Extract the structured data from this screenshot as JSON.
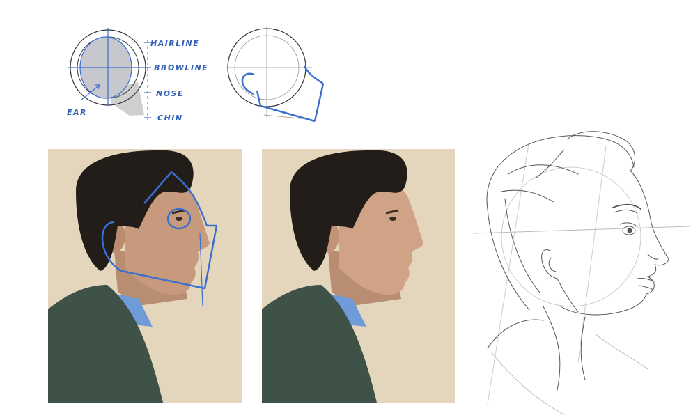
{
  "labels": {
    "hairline": "HAIRLINE",
    "browline": "BROWLINE",
    "nose": "NOSE",
    "chin": "CHIN",
    "ear": "EAR"
  },
  "colors": {
    "guide_blue": "#3a6fd0",
    "pencil_gray": "#555555",
    "backdrop": "#e4d6bd",
    "hair": "#231d19",
    "skin": "#c79a7e",
    "shirt": "#6f9bd8",
    "jacket": "#3f5248"
  },
  "panels": [
    {
      "name": "profile-photo-with-guides",
      "overlay": true
    },
    {
      "name": "profile-photo",
      "overlay": false
    },
    {
      "name": "pencil-sketch",
      "overlay": false
    }
  ]
}
